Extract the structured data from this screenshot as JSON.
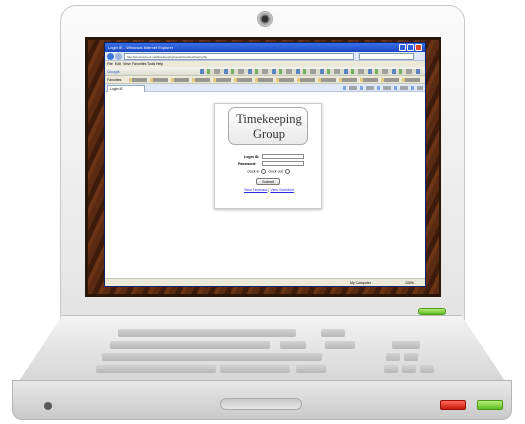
{
  "browser": {
    "window_title": "Login IE - Windows Internet Explorer",
    "url": "http://procurement.net/timekeeping/sess/timesheet/login.php",
    "menu": [
      "File",
      "Edit",
      "View",
      "Favorites",
      "Tools",
      "Help"
    ],
    "search_engine_label": "Google",
    "favorites_label": "Favorites",
    "tab_label": "Login IE",
    "status_zone": "My Computer",
    "status_zoom": "100%"
  },
  "login": {
    "logo_line1": "Timekeeping",
    "logo_line2": "Group",
    "login_id_label": "Login ID:",
    "password_label": "Password:",
    "clock_in_label": "clock in",
    "clock_out_label": "clock out",
    "submit_label": "Submit",
    "link_timecard": "View Timecard",
    "link_separator": "|",
    "link_schedule": "View Schedule"
  },
  "colors": {
    "titlebar": "#1d48c2",
    "link": "#2a2adf",
    "power_red": "#c8190b",
    "power_green": "#5dbb1e"
  }
}
